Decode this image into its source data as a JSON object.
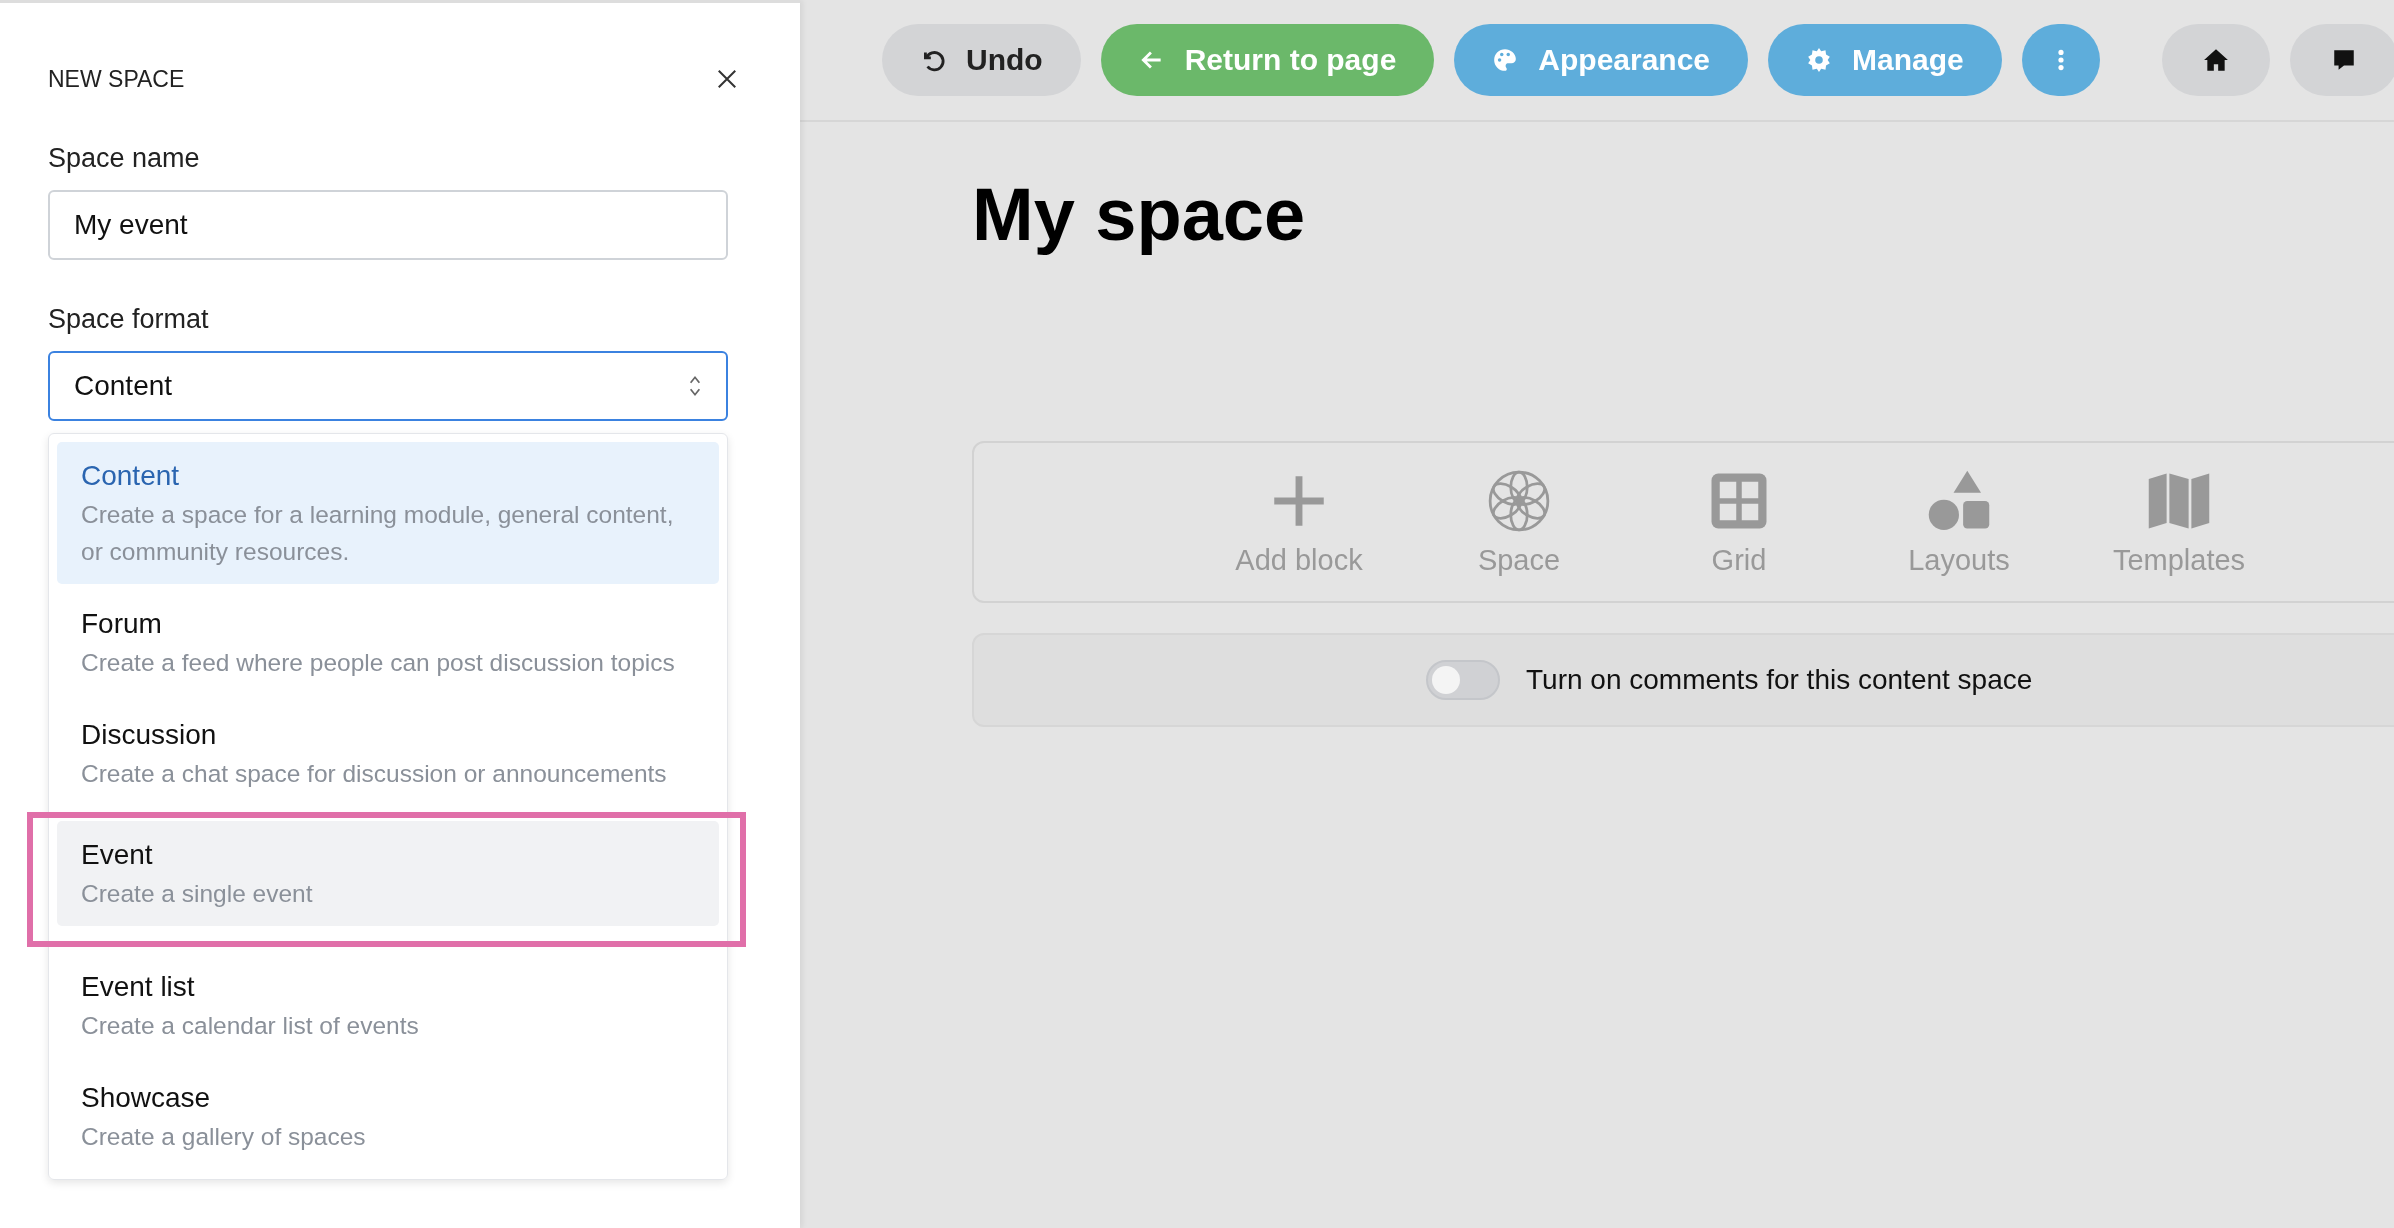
{
  "panel": {
    "title": "NEW SPACE",
    "fields": [
      {
        "label": "Space name",
        "kind": "text",
        "value": "My event",
        "focused": false
      },
      {
        "label": "Space format",
        "kind": "select",
        "value": "Content",
        "focused": true
      }
    ],
    "options": [
      {
        "title": "Content",
        "description": "Create a space for a learning module, general content, or community resources.",
        "selected": true,
        "hovered": false,
        "outlined": false
      },
      {
        "title": "Forum",
        "description": "Create a feed where people can post discussion topics",
        "selected": false,
        "hovered": false,
        "outlined": false
      },
      {
        "title": "Discussion",
        "description": "Create a chat space for discussion or announcements",
        "selected": false,
        "hovered": false,
        "outlined": false
      },
      {
        "title": "Event",
        "description": "Create a single event",
        "selected": false,
        "hovered": true,
        "outlined": true
      },
      {
        "title": "Event list",
        "description": "Create a calendar list of events",
        "selected": false,
        "hovered": false,
        "outlined": false
      },
      {
        "title": "Showcase",
        "description": "Create a gallery of spaces",
        "selected": false,
        "hovered": false,
        "outlined": false
      }
    ]
  },
  "toolbar": {
    "buttons": [
      {
        "kind": "secondary",
        "label": "Undo"
      },
      {
        "kind": "primary",
        "label": "Return to page"
      },
      {
        "kind": "accent",
        "label": "Appearance"
      },
      {
        "kind": "accent",
        "label": "Manage"
      },
      {
        "kind": "accent"
      }
    ]
  },
  "page": {
    "title": "My space",
    "blocks": [
      {
        "label": "Add block"
      },
      {
        "label": "Space"
      },
      {
        "label": "Grid"
      },
      {
        "label": "Layouts"
      },
      {
        "label": "Templates"
      }
    ],
    "comments": {
      "label": "Turn on comments for this content space",
      "on": false
    }
  }
}
